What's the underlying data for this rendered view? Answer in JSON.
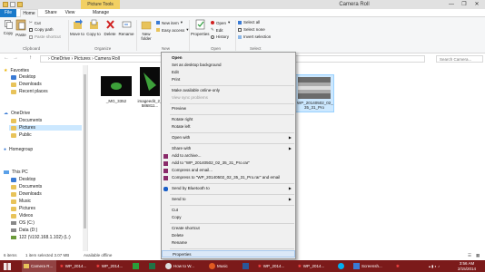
{
  "window": {
    "title": "Camera Roll",
    "contextual_tab": "Picture Tools",
    "controls": [
      "—",
      "❐",
      "✕"
    ]
  },
  "tabs": [
    {
      "label": "File"
    },
    {
      "label": "Home"
    },
    {
      "label": "Share"
    },
    {
      "label": "View"
    },
    {
      "label": "Manage"
    }
  ],
  "ribbon": {
    "clipboard": {
      "group_label": "Clipboard",
      "copy": "Copy",
      "paste": "Paste",
      "cut": "Cut",
      "copy_path": "Copy path",
      "paste_shortcut": "Paste shortcut"
    },
    "organize": {
      "group_label": "Organize",
      "move_to": "Move to",
      "copy_to": "Copy to",
      "delete": "Delete",
      "rename": "Rename"
    },
    "new": {
      "group_label": "New",
      "new_folder": "New folder",
      "new_item": "New item",
      "easy_access": "Easy access"
    },
    "open": {
      "group_label": "Open",
      "properties": "Properties",
      "open": "Open",
      "edit": "Edit",
      "history": "History"
    },
    "select": {
      "group_label": "Select",
      "select_all": "Select all",
      "select_none": "Select none",
      "invert_selection": "Invert selection"
    }
  },
  "address": {
    "back": "←",
    "forward": "→",
    "up": "↑",
    "path": "›  OneDrive  ›  Pictures  ›  Camera Roll",
    "search_placeholder": "Search Camera..."
  },
  "nav": {
    "favorites": "Favorites",
    "desktop": "Desktop",
    "downloads": "Downloads",
    "recent_places": "Recent places",
    "onedrive": "OneDrive",
    "documents": "Documents",
    "pictures": "Pictures",
    "public": "Public",
    "homegroup": "Homegroup",
    "this_pc": "This PC",
    "pc_desktop": "Desktop",
    "pc_documents": "Documents",
    "pc_downloads": "Downloads",
    "pc_music": "Music",
    "pc_pictures": "Pictures",
    "pc_videos": "Videos",
    "os_c": "OS (C:)",
    "data_d": "Data (D:)",
    "share_drive": "122 (\\\\192.168.1.102) (L:)"
  },
  "files": [
    {
      "name": "_MG_3352"
    },
    {
      "name": "imageedit_2_\n586811..."
    },
    {
      "name": "WP_20140502_02_\n35_31_Pro"
    }
  ],
  "status": {
    "items": "6 items",
    "selected": "1 item selected  3.07 MB",
    "availability": "Available offline"
  },
  "context_menu": {
    "open": "Open",
    "set_desktop": "Set as desktop background",
    "edit": "Edit",
    "print": "Print",
    "make_available": "Make available online-only",
    "view_sync": "View sync problems",
    "preview": "Preview",
    "rotate_right": "Rotate right",
    "rotate_left": "Rotate left",
    "open_with": "Open with",
    "share_with": "Share with",
    "add_archive": "Add to archive...",
    "add_rar": "Add to \"WP_20140502_02_35_31_Pro.rar\"",
    "compress_email": "Compress and email...",
    "compress_rar_email": "Compress to \"WP_20140502_02_35_31_Pro.rar\" and email",
    "send_bluetooth": "Send by Bluetooth to",
    "send_to": "Send to",
    "cut": "Cut",
    "copy": "Copy",
    "create_shortcut": "Create shortcut",
    "delete": "Delete",
    "rename": "Rename",
    "properties": "Properties"
  },
  "taskbar": {
    "items": [
      {
        "label": "Camera R..."
      },
      {
        "label": "WP_2014..."
      },
      {
        "label": "WP_2014..."
      },
      {
        "label": "How to W..."
      },
      {
        "label": "Music"
      },
      {
        "label": "WP_2014..."
      },
      {
        "label": "WP_2014..."
      },
      {
        "label": "Screensh..."
      }
    ],
    "time": "3:56 AM",
    "date": "2/15/2014"
  },
  "colors": {
    "accent": "#1979ca",
    "taskbar": "#7b1a1a",
    "selection": "#cce8ff",
    "contextual_tab": "#f2d063"
  }
}
